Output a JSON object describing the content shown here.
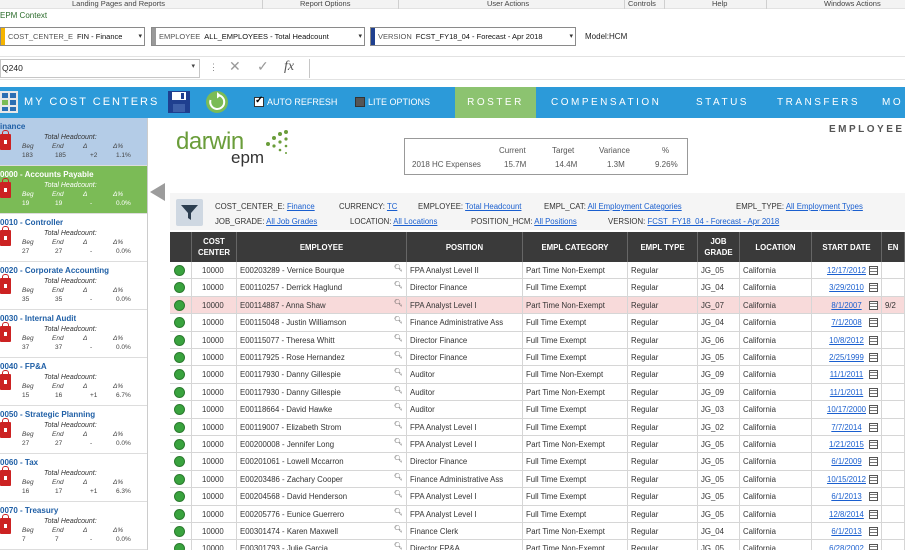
{
  "ribbon": {
    "groups": [
      "Landing Pages and Reports",
      "Report Options",
      "User Actions",
      "Controls",
      "Help",
      "Windows Actions"
    ]
  },
  "context_title": "EPM Context",
  "context": {
    "cost_center": {
      "key": "COST_CENTER_E",
      "value": "FIN - Finance",
      "color": "#f5b400"
    },
    "employee": {
      "key": "EMPLOYEE",
      "value": "ALL_EMPLOYEES - Total Headcount",
      "color": "#999999"
    },
    "version": {
      "key": "VERSION",
      "value": "FCST_FY18_04 - Forecast - Apr 2018",
      "color": "#1f3f8f"
    },
    "model": "Model:HCM"
  },
  "formula_bar": {
    "name_box": "Q240",
    "formula": ""
  },
  "header": {
    "my_cost_centers": "MY COST CENTERS",
    "auto_refresh": {
      "label": "AUTO REFRESH",
      "checked": true
    },
    "lite_options": {
      "label": "LITE OPTIONS",
      "checked": false
    },
    "tabs": [
      "ROSTER",
      "COMPENSATION",
      "STATUS",
      "TRANSFERS",
      "MO"
    ],
    "active_tab": "ROSTER"
  },
  "logo": {
    "darwin": "darwin",
    "epm": "epm"
  },
  "page_title": "EMPLOYEE",
  "expenses": {
    "headers": [
      "Current",
      "Target",
      "Variance",
      "%"
    ],
    "label": "2018 HC Expenses",
    "values": [
      "15.7M",
      "14.4M",
      "1.3M",
      "9.26%"
    ]
  },
  "filters": [
    {
      "key": "COST_CENTER_E:",
      "value": "Finance"
    },
    {
      "key": "CURRENCY:",
      "value": "TC"
    },
    {
      "key": "EMPLOYEE:",
      "value": "Total Headcount"
    },
    {
      "key": "EMPL_CAT:",
      "value": "All Employment Categories"
    },
    {
      "key": "EMPL_TYPE:",
      "value": "All Employment Types"
    },
    {
      "key": "JOB_GRADE:",
      "value": "All Job Grades"
    },
    {
      "key": "LOCATION:",
      "value": "All Locations"
    },
    {
      "key": "POSITION_HCM:",
      "value": "All Positions"
    },
    {
      "key": "VERSION:",
      "value": "FCST_FY18_04 - Forecast - Apr 2018"
    }
  ],
  "cost_centers": [
    {
      "name": "inance",
      "th": "Total Headcount:",
      "labels": [
        "Beg",
        "End",
        "Δ",
        "Δ%"
      ],
      "values": [
        "183",
        "185",
        "+2",
        "1.1%"
      ],
      "state": "highlight"
    },
    {
      "name": "0000 - Accounts Payable",
      "th": "Total Headcount:",
      "labels": [
        "Beg",
        "End",
        "Δ",
        "Δ%"
      ],
      "values": [
        "19",
        "19",
        "-",
        "0.0%"
      ],
      "state": "selected"
    },
    {
      "name": "0010 - Controller",
      "th": "Total Headcount:",
      "labels": [
        "Beg",
        "End",
        "Δ",
        "Δ%"
      ],
      "values": [
        "27",
        "27",
        "-",
        "0.0%"
      ],
      "state": ""
    },
    {
      "name": "0020 - Corporate Accounting",
      "th": "Total Headcount:",
      "labels": [
        "Beg",
        "End",
        "Δ",
        "Δ%"
      ],
      "values": [
        "35",
        "35",
        "-",
        "0.0%"
      ],
      "state": ""
    },
    {
      "name": "0030 - Internal Audit",
      "th": "Total Headcount:",
      "labels": [
        "Beg",
        "End",
        "Δ",
        "Δ%"
      ],
      "values": [
        "37",
        "37",
        "-",
        "0.0%"
      ],
      "state": ""
    },
    {
      "name": "0040 - FP&A",
      "th": "Total Headcount:",
      "labels": [
        "Beg",
        "End",
        "Δ",
        "Δ%"
      ],
      "values": [
        "15",
        "16",
        "+1",
        "6.7%"
      ],
      "state": ""
    },
    {
      "name": "0050 - Strategic Planning",
      "th": "Total Headcount:",
      "labels": [
        "Beg",
        "End",
        "Δ",
        "Δ%"
      ],
      "values": [
        "27",
        "27",
        "-",
        "0.0%"
      ],
      "state": ""
    },
    {
      "name": "0060 - Tax",
      "th": "Total Headcount:",
      "labels": [
        "Beg",
        "End",
        "Δ",
        "Δ%"
      ],
      "values": [
        "16",
        "17",
        "+1",
        "6.3%"
      ],
      "state": ""
    },
    {
      "name": "0070 - Treasury",
      "th": "Total Headcount:",
      "labels": [
        "Beg",
        "End",
        "Δ",
        "Δ%"
      ],
      "values": [
        "7",
        "7",
        "-",
        "0.0%"
      ],
      "state": ""
    }
  ],
  "grid": {
    "headers": [
      "",
      "COST\nCENTER",
      "EMPLOYEE",
      "POSITION",
      "EMPL CATEGORY",
      "EMPL TYPE",
      "JOB\nGRADE",
      "LOCATION",
      "START DATE",
      "EN"
    ],
    "rows": [
      [
        "10000",
        "E00203289 - Vernice Bourque",
        "FPA Analyst Level II",
        "Part Time Non-Exempt",
        "Regular",
        "JG_05",
        "California",
        "12/17/2012",
        ""
      ],
      [
        "10000",
        "E00110257 - Derrick Haglund",
        "Director Finance",
        "Full Time Exempt",
        "Regular",
        "JG_04",
        "California",
        "3/29/2010",
        ""
      ],
      [
        "10000",
        "E00114887 - Anna Shaw",
        "FPA Analyst Level I",
        "Part Time Non-Exempt",
        "Regular",
        "JG_07",
        "California",
        "8/1/2007",
        "9/2"
      ],
      [
        "10000",
        "E00115048 - Justin Williamson",
        "Finance Administrative Ass",
        "Full Time Exempt",
        "Regular",
        "JG_04",
        "California",
        "7/1/2008",
        ""
      ],
      [
        "10000",
        "E00115077 - Theresa Whitt",
        "Director Finance",
        "Full Time Exempt",
        "Regular",
        "JG_06",
        "California",
        "10/8/2012",
        ""
      ],
      [
        "10000",
        "E00117925 - Rose Hernandez",
        "Director Finance",
        "Full Time Exempt",
        "Regular",
        "JG_05",
        "California",
        "2/25/1999",
        ""
      ],
      [
        "10000",
        "E00117930 - Danny Gillespie",
        "Auditor",
        "Full Time Non-Exempt",
        "Regular",
        "JG_09",
        "California",
        "11/1/2011",
        ""
      ],
      [
        "10000",
        "E00117930 - Danny Gillespie",
        "Auditor",
        "Part Time Non-Exempt",
        "Regular",
        "JG_09",
        "California",
        "11/1/2011",
        ""
      ],
      [
        "10000",
        "E00118664 - David Hawke",
        "Auditor",
        "Full Time Exempt",
        "Regular",
        "JG_03",
        "California",
        "10/17/2000",
        ""
      ],
      [
        "10000",
        "E00119007 - Elizabeth Strom",
        "FPA Analyst Level I",
        "Full Time Exempt",
        "Regular",
        "JG_02",
        "California",
        "7/7/2014",
        ""
      ],
      [
        "10000",
        "E00200008 - Jennifer Long",
        "FPA Analyst Level I",
        "Part Time Non-Exempt",
        "Regular",
        "JG_05",
        "California",
        "1/21/2015",
        ""
      ],
      [
        "10000",
        "E00201061 - Lowell Mccarron",
        "Director Finance",
        "Full Time Exempt",
        "Regular",
        "JG_05",
        "California",
        "6/1/2009",
        ""
      ],
      [
        "10000",
        "E00203486 - Zachary Cooper",
        "Finance Administrative Ass",
        "Full Time Exempt",
        "Regular",
        "JG_05",
        "California",
        "10/15/2012",
        ""
      ],
      [
        "10000",
        "E00204568 - David Henderson",
        "FPA Analyst Level I",
        "Full Time Exempt",
        "Regular",
        "JG_05",
        "California",
        "6/1/2013",
        ""
      ],
      [
        "10000",
        "E00205776 - Eunice Guerrero",
        "FPA Analyst Level I",
        "Full Time Exempt",
        "Regular",
        "JG_05",
        "California",
        "12/8/2014",
        ""
      ],
      [
        "10000",
        "E00301474 - Karen Maxwell",
        "Finance Clerk",
        "Part Time Non-Exempt",
        "Regular",
        "JG_04",
        "California",
        "6/1/2013",
        ""
      ],
      [
        "10000",
        "E00301793 - Julie Garcia",
        "Director FP&A",
        "Part Time Non-Exempt",
        "Regular",
        "JG_05",
        "California",
        "6/28/2002",
        ""
      ]
    ],
    "highlight_row": 2
  }
}
